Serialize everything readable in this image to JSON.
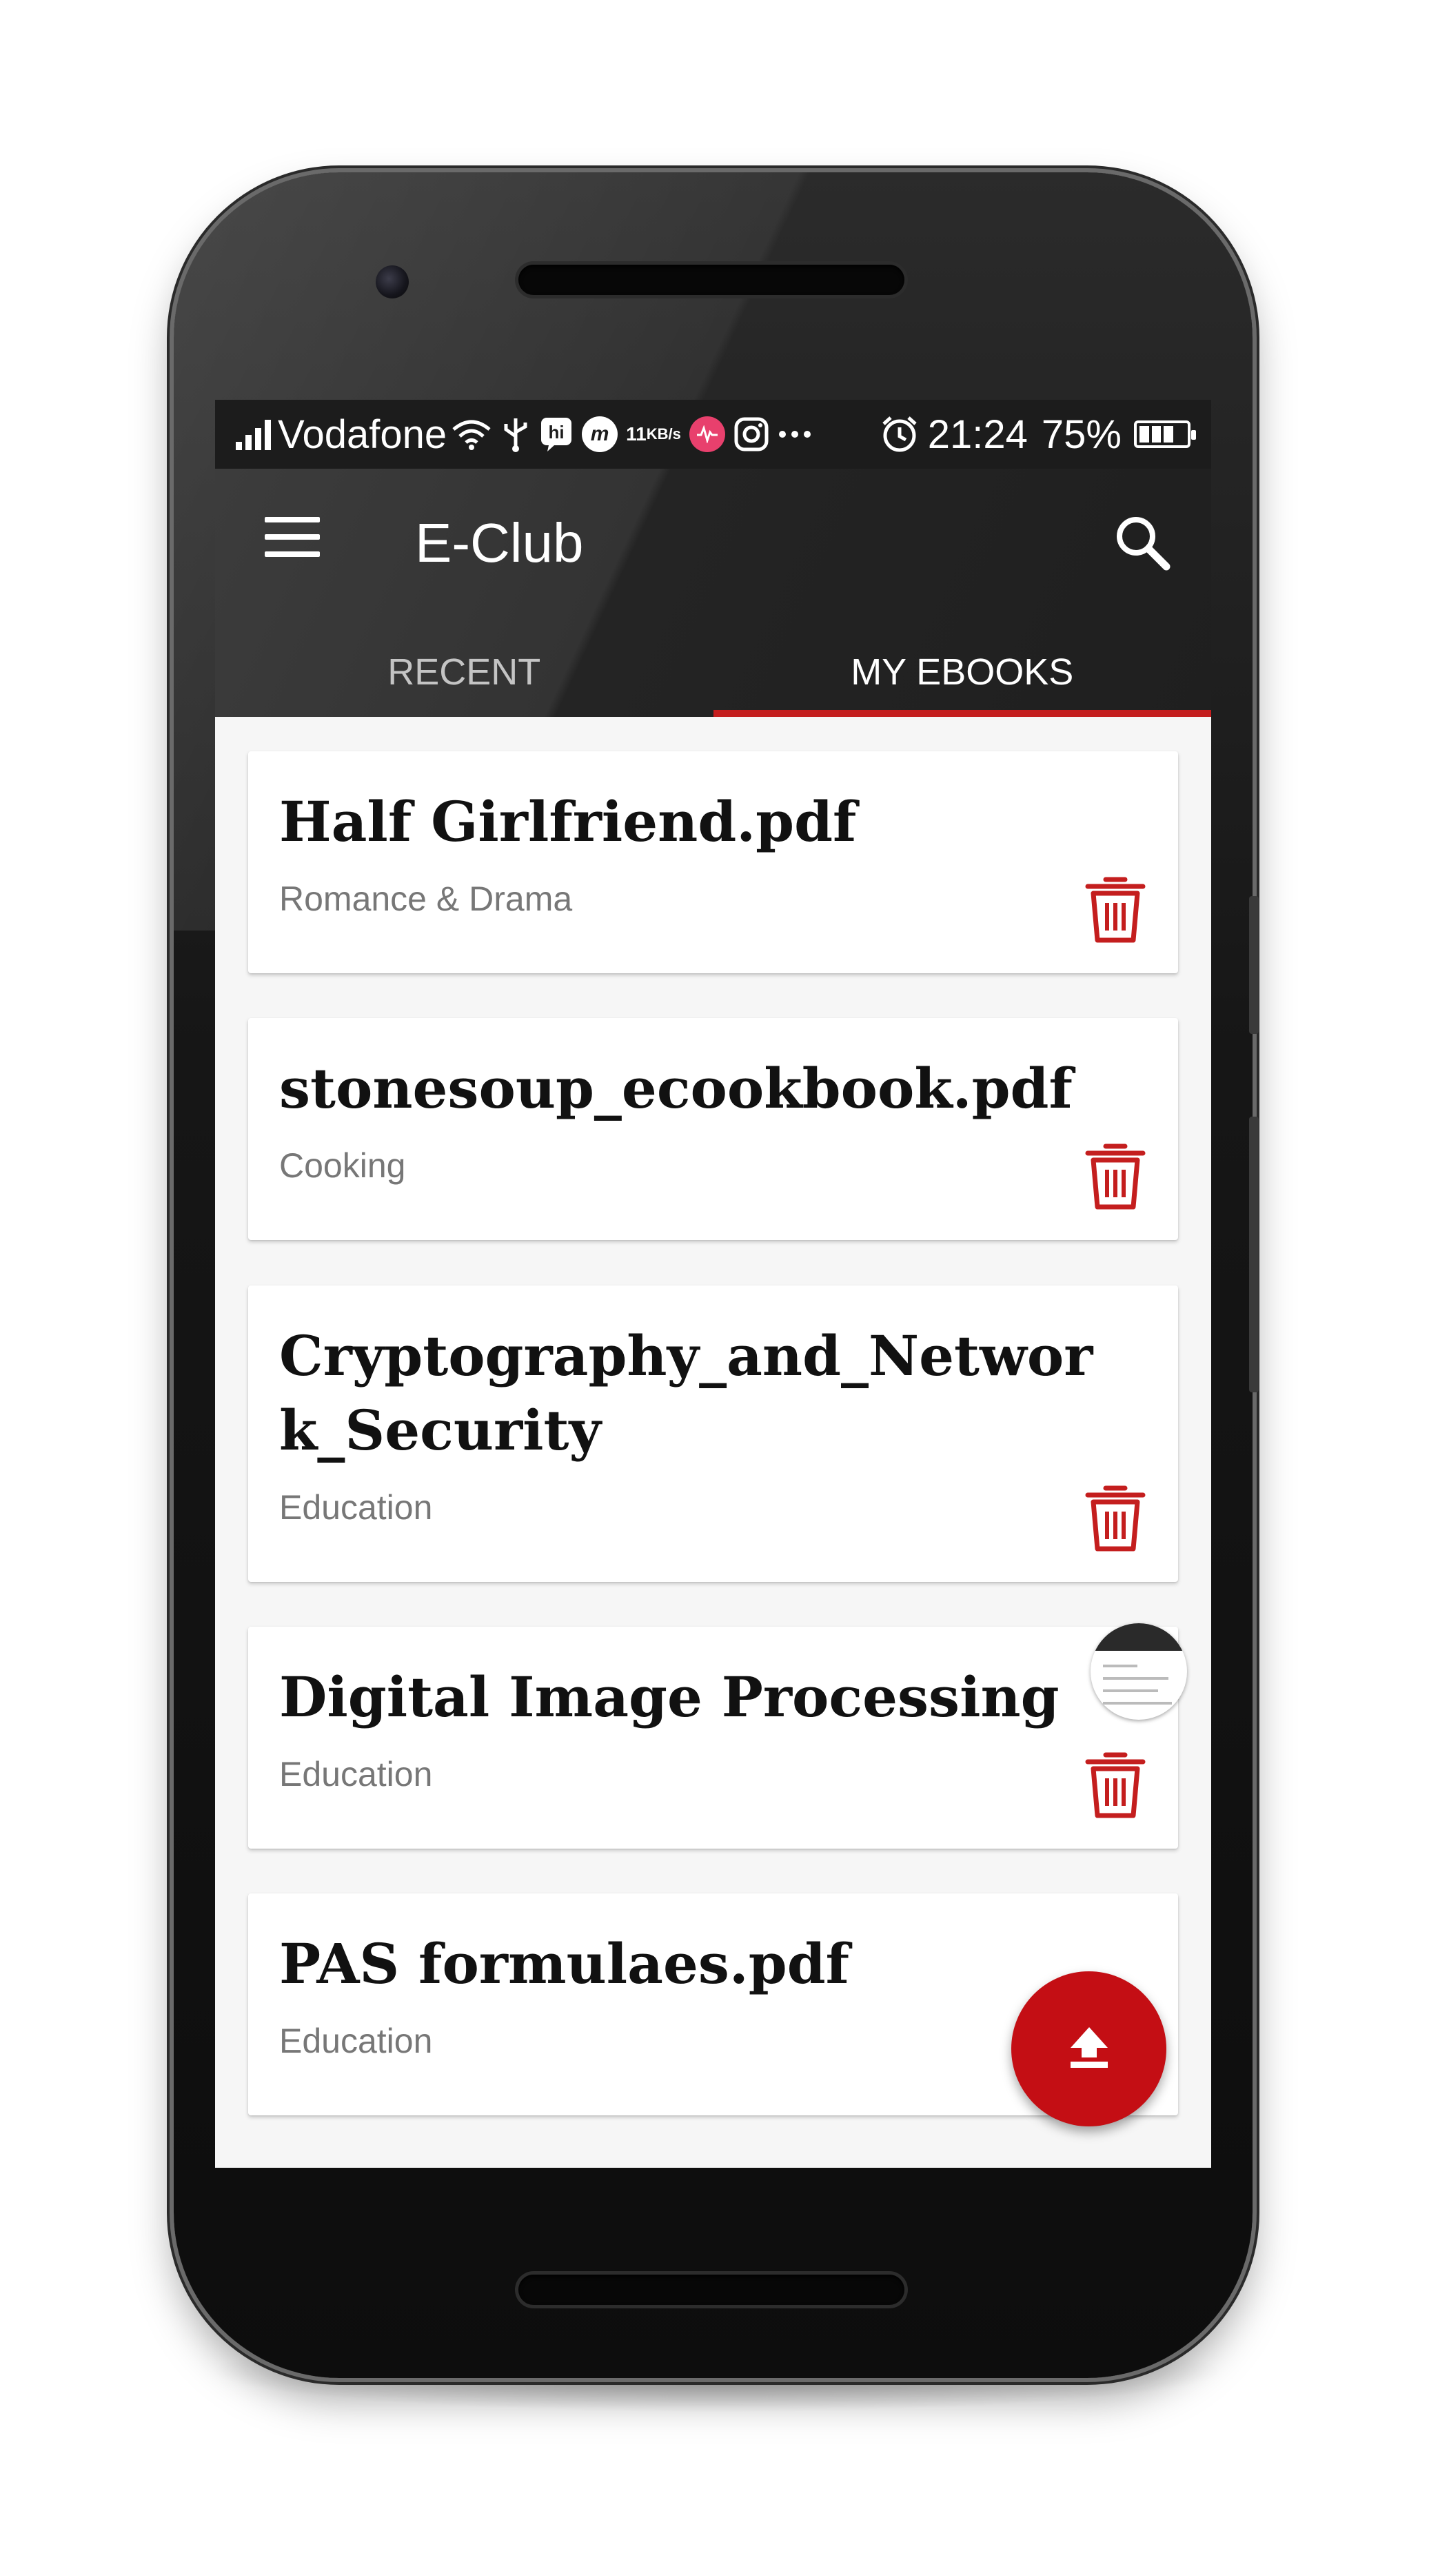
{
  "statusbar": {
    "carrier": "Vodafone",
    "net_speed_value": "11",
    "net_speed_unit": "KB/s",
    "m_badge": "m",
    "time": "21:24",
    "battery": "75%",
    "icons": [
      "signal-icon",
      "wifi-icon",
      "usb-icon",
      "hike-icon",
      "m-app-icon",
      "musically-icon",
      "instagram-icon",
      "more-icon",
      "alarm-icon",
      "battery-icon"
    ]
  },
  "appbar": {
    "title": "E-Club",
    "menu_icon": "menu-icon",
    "search_icon": "search-icon"
  },
  "tabs": [
    {
      "label": "RECENT",
      "active": false
    },
    {
      "label": "MY EBOOKS",
      "active": true
    }
  ],
  "ebooks": [
    {
      "title": "Half Girlfriend.pdf",
      "category": "Romance & Drama"
    },
    {
      "title": "stonesoup_ecookbook.pdf",
      "category": "Cooking"
    },
    {
      "title": "Cryptography_and_Network_Security",
      "category": "Education"
    },
    {
      "title": "Digital Image Processing",
      "category": "Education"
    },
    {
      "title": "PAS formulaes.pdf",
      "category": "Education"
    }
  ],
  "fab": {
    "icon": "upload-icon"
  },
  "colors": {
    "accent": "#c41e1e",
    "fab": "#c40e14",
    "appbar": "#2c2c2c",
    "statusbar": "#1c1c1c",
    "trash": "#c41e1e"
  }
}
